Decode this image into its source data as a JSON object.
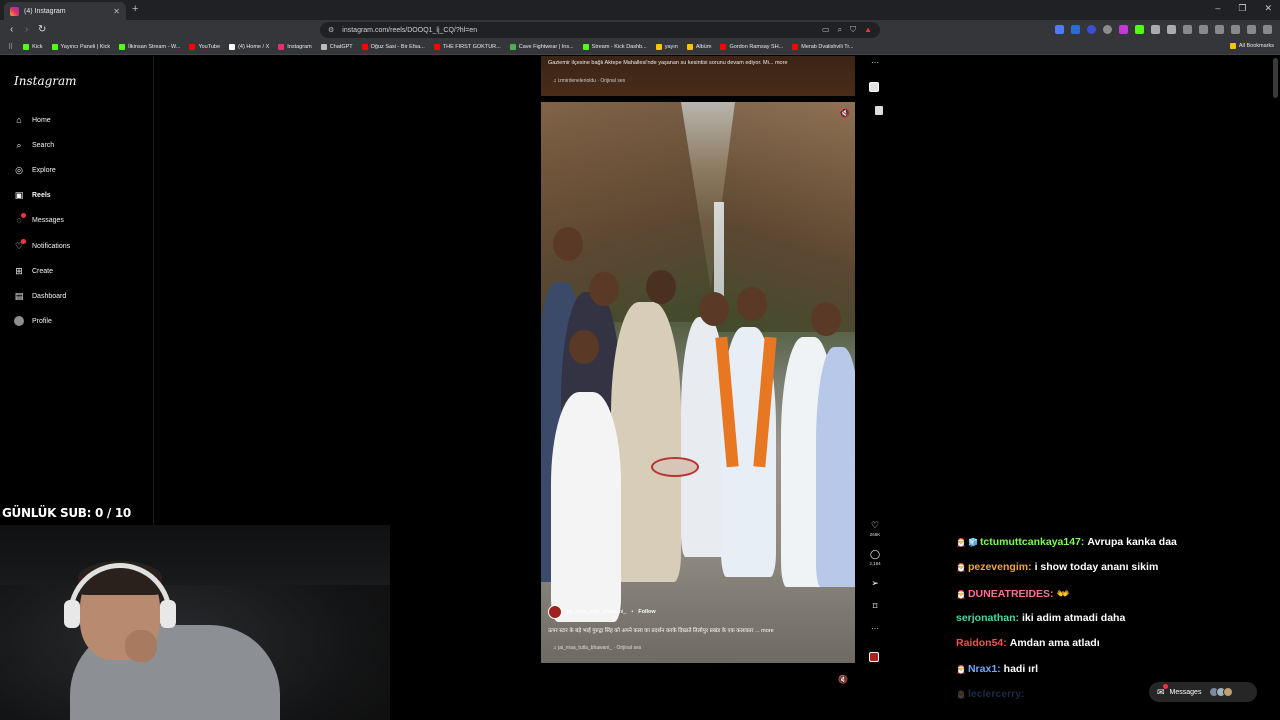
{
  "browser": {
    "tab": {
      "title": "(4) Instagram"
    },
    "url": "instagram.com/reels/DOOQ1_lj_CQ/?hl=en",
    "window_controls": [
      "–",
      "❐",
      "✕"
    ],
    "bookmarks": [
      {
        "label": "Kick",
        "color": "#53fc18"
      },
      {
        "label": "Yayıncı Paneli | Kick",
        "color": "#53fc18"
      },
      {
        "label": "İlkinsan Stream - W...",
        "color": "#53fc18"
      },
      {
        "label": "YouTube",
        "color": "#ff0000"
      },
      {
        "label": "(4) Home / X",
        "color": "#ffffff"
      },
      {
        "label": "Instagram",
        "color": "#e1306c"
      },
      {
        "label": "ChatGPT",
        "color": "#bbbbbb"
      },
      {
        "label": "Oğuz Sasi - Bir Efsa...",
        "color": "#ff0000"
      },
      {
        "label": "THE FIRST GOKTUR...",
        "color": "#ff0000"
      },
      {
        "label": "Cave Fightwear | Ins...",
        "color": "#4caf50"
      },
      {
        "label": "Stream - Kick Dashb...",
        "color": "#53fc18"
      },
      {
        "label": "yayın",
        "color": "#f9c400"
      },
      {
        "label": "Albüm",
        "color": "#f9c400"
      },
      {
        "label": "Gordon Ramsay SH...",
        "color": "#ff0000"
      },
      {
        "label": "Merab Dvalishvili Tr...",
        "color": "#ff0000"
      }
    ],
    "all_bookmarks": "All Bookmarks"
  },
  "instagram": {
    "logo": "Instagram",
    "nav": [
      {
        "label": "Home",
        "icon": "home-icon",
        "glyph": "⌂"
      },
      {
        "label": "Search",
        "icon": "search-icon",
        "glyph": "⌕"
      },
      {
        "label": "Explore",
        "icon": "compass-icon",
        "glyph": "◎"
      },
      {
        "label": "Reels",
        "icon": "reels-icon",
        "glyph": "▣"
      },
      {
        "label": "Messages",
        "icon": "messenger-icon",
        "glyph": "◌"
      },
      {
        "label": "Notifications",
        "icon": "heart-icon",
        "glyph": "♡"
      },
      {
        "label": "Create",
        "icon": "plus-square-icon",
        "glyph": "⊞"
      },
      {
        "label": "Dashboard",
        "icon": "dashboard-icon",
        "glyph": "▤"
      },
      {
        "label": "Profile",
        "icon": "avatar-icon",
        "glyph": ""
      }
    ],
    "prev_reel": {
      "caption": "Gaziemir ilçesine bağlı Aktepe Mahallesi'nde yaşanan su kesintisi sorunu devam ediyor. Mi... more",
      "audio": "♫ izmirdenelerioldu · Orijinal ses"
    },
    "reel": {
      "username": "jai_maa_tutla_bhawani_",
      "follow": "Follow",
      "caption": "ऊपर स्टार के बड़े भाई गुरुद्वा सिंह को अपने कला का प्रदर्शन करके दिखाते तिलोपुर प्रखंड के एक कलाकार ... more",
      "audio": "♫ jai_maa_tutla_bhawani_ · Orijinal ses"
    },
    "actions": {
      "likes": "266K",
      "comments": "2,184"
    },
    "messages_pill": "Messages"
  },
  "stream_overlay": {
    "daily_sub": "GÜNLÜK SUB: 0 / 10",
    "chat": [
      {
        "user": "tctumuttcankaya147:",
        "message": "Avrupa kanka daa",
        "color": "#7cfc4f",
        "badge": "🧊"
      },
      {
        "user": "pezevengim:",
        "message": "i show today ananı sikim",
        "color": "#f2a541",
        "badge": ""
      },
      {
        "user": "DUNEATREIDES:",
        "message": "👐",
        "color": "#ff6f91",
        "badge": ""
      },
      {
        "user": "serjonathan:",
        "message": "iki adim atmadi daha",
        "color": "#4fd6a0",
        "badge": ""
      },
      {
        "user": "Raidon54:",
        "message": "Amdan ama atladı",
        "color": "#ff4b4b",
        "badge": ""
      },
      {
        "user": "Nrax1:",
        "message": "hadi ırl",
        "color": "#6fa8ff",
        "badge": ""
      },
      {
        "user": "leclercerry:",
        "message": "",
        "color": "#6fa8ff",
        "badge": ""
      }
    ]
  }
}
